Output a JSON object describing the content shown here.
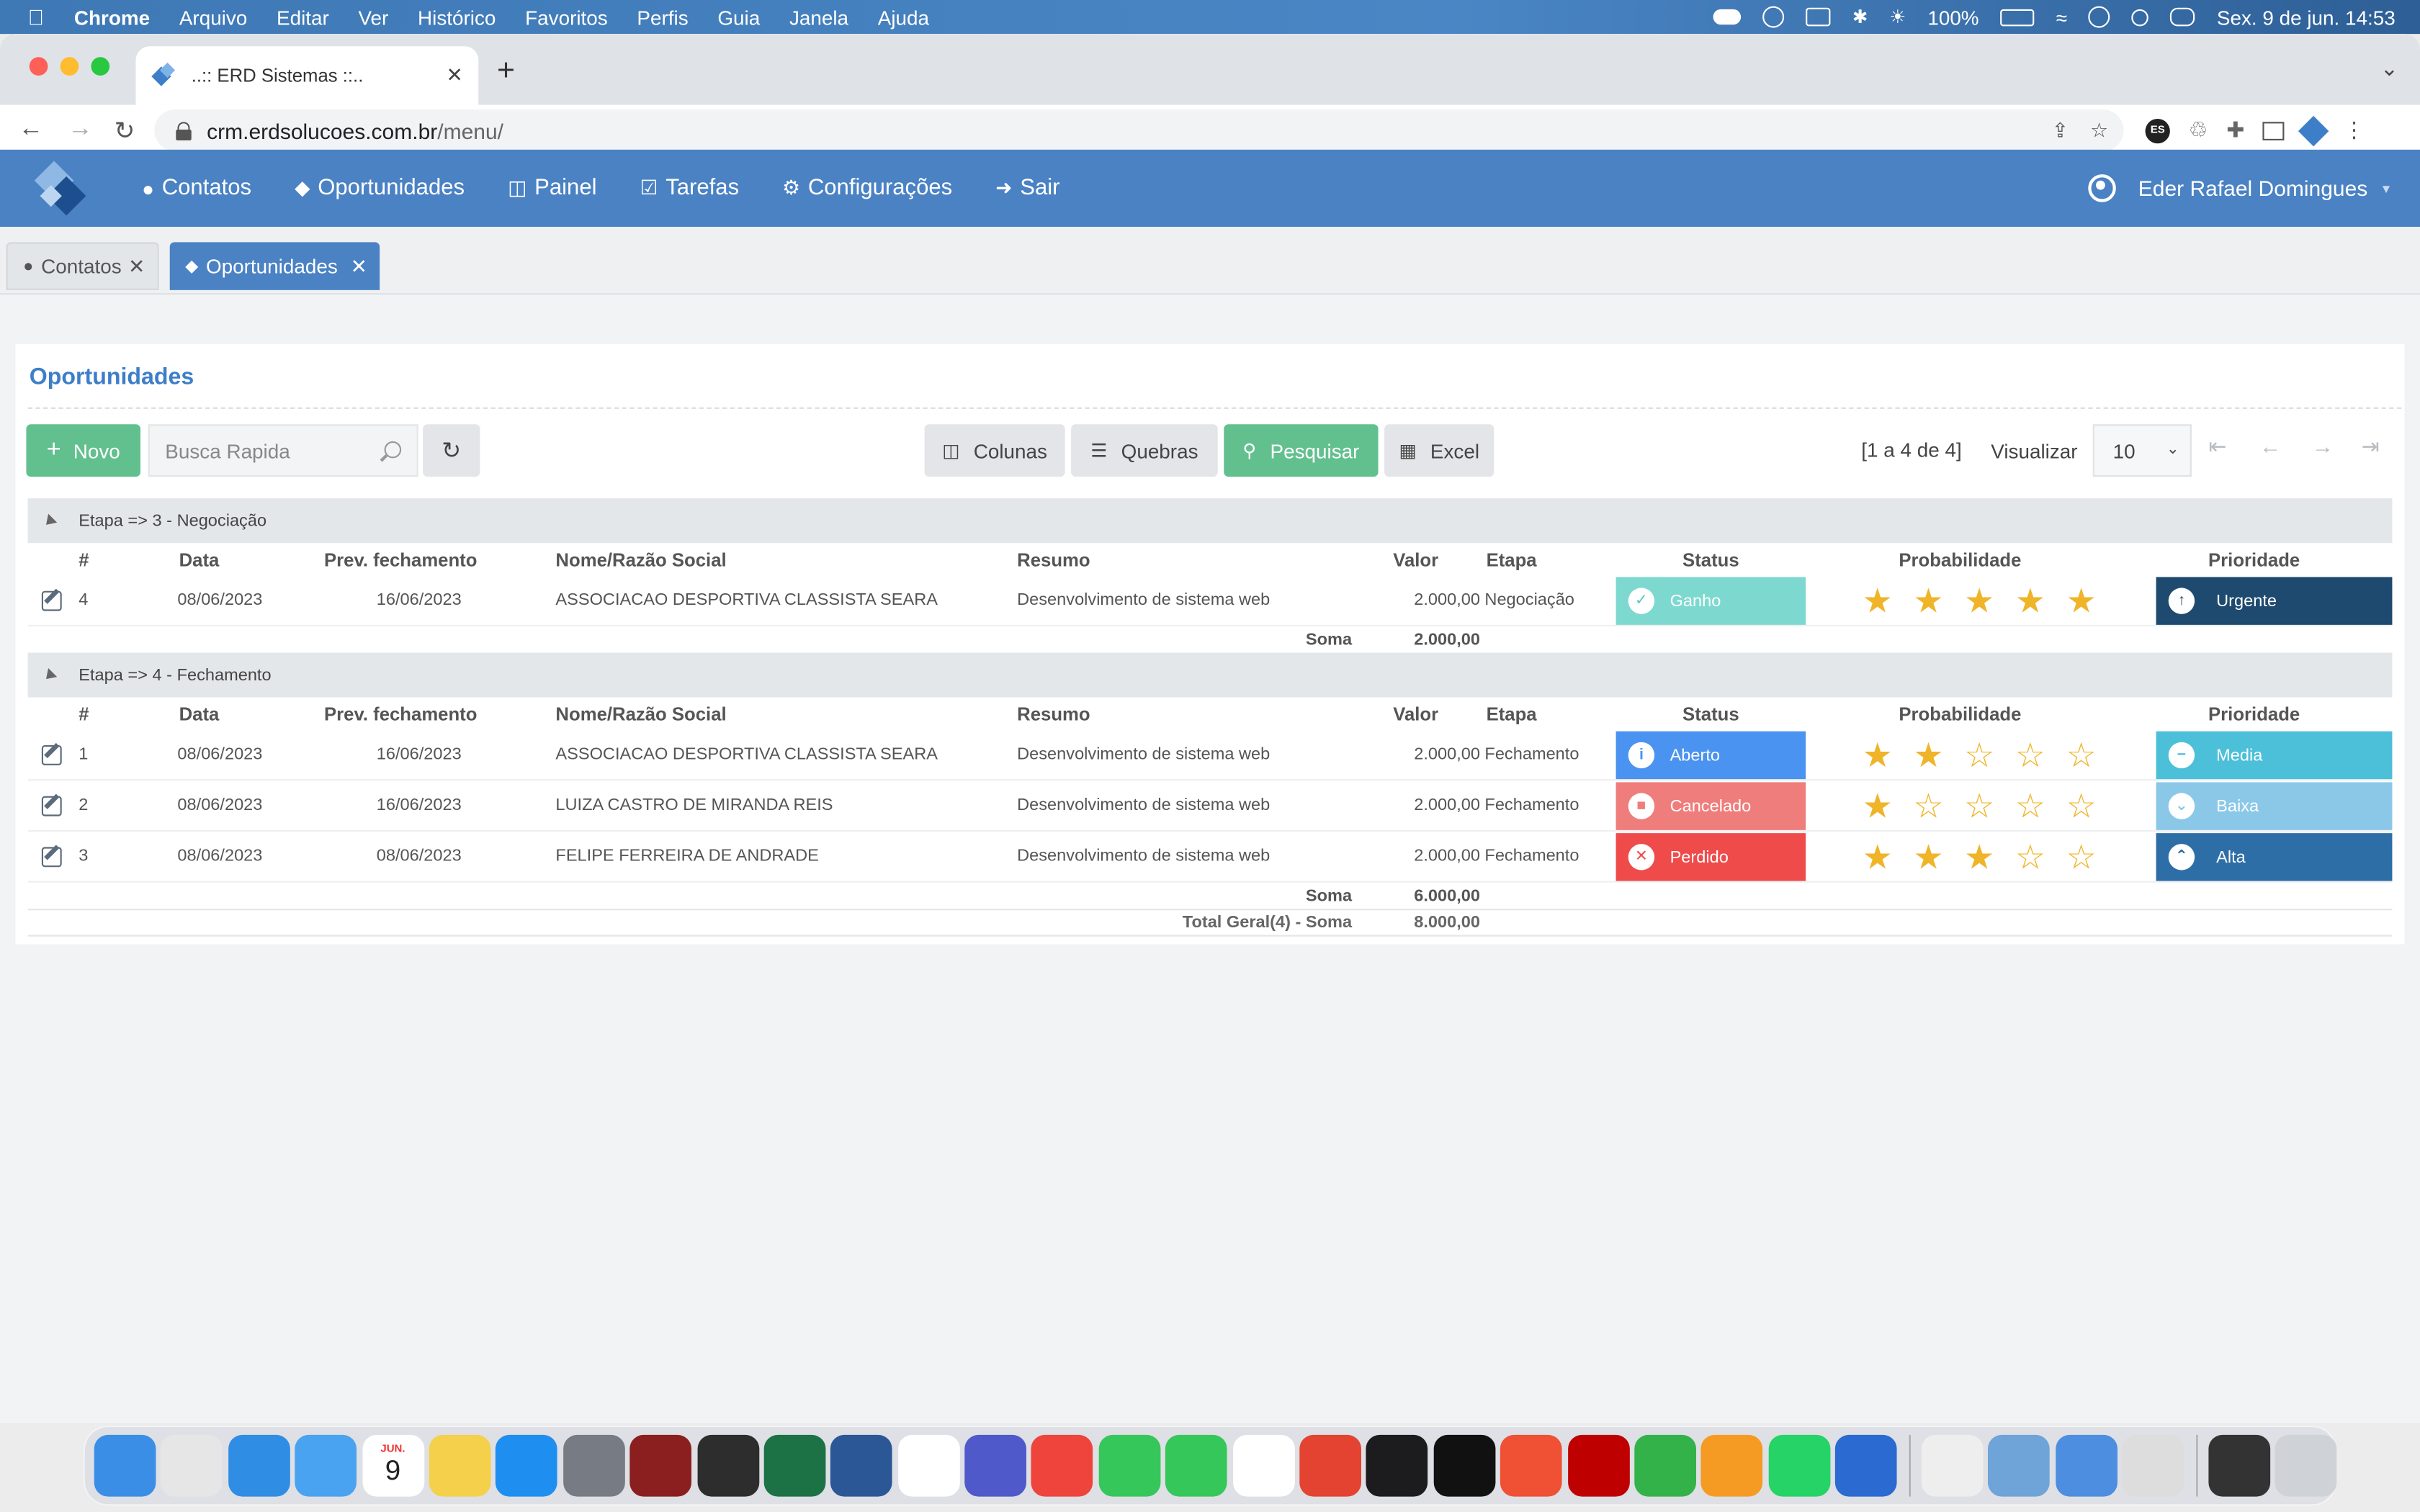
{
  "os_menubar": {
    "app": "Chrome",
    "items": [
      "Arquivo",
      "Editar",
      "Ver",
      "Histórico",
      "Favoritos",
      "Perfis",
      "Guia",
      "Janela",
      "Ajuda"
    ],
    "battery": "100%",
    "datetime": "Sex. 9 de jun.  14:53"
  },
  "browser": {
    "tab_title": "..:: ERD Sistemas ::..",
    "url_host": "crm.erdsolucoes.com.br",
    "url_path": "/menu/",
    "extension_badge": "ES"
  },
  "app_nav": {
    "items": [
      {
        "label": "Contatos",
        "icon": "user-icon"
      },
      {
        "label": "Oportunidades",
        "icon": "tags-icon"
      },
      {
        "label": "Painel",
        "icon": "columns-icon"
      },
      {
        "label": "Tarefas",
        "icon": "check-square-icon"
      },
      {
        "label": "Configurações",
        "icon": "cogs-icon"
      },
      {
        "label": "Sair",
        "icon": "sign-out-icon"
      }
    ],
    "user_name": "Eder Rafael Domingues"
  },
  "page_tabs": [
    {
      "label": "Contatos",
      "active": false
    },
    {
      "label": "Oportunidades",
      "active": true
    }
  ],
  "panel": {
    "title": "Oportunidades",
    "toolbar": {
      "novo": "Novo",
      "search_placeholder": "Busca Rapida",
      "colunas": "Colunas",
      "quebras": "Quebras",
      "pesquisar": "Pesquisar",
      "excel": "Excel",
      "record_count": "[1 a 4 de 4]",
      "visualizar_label": "Visualizar",
      "visualizar_value": "10"
    }
  },
  "columns": {
    "num": "#",
    "data": "Data",
    "prev": "Prev. fechamento",
    "nome": "Nome/Razão Social",
    "resumo": "Resumo",
    "valor": "Valor",
    "etapa": "Etapa",
    "status": "Status",
    "prob": "Probabilidade",
    "prio": "Prioridade"
  },
  "groups": [
    {
      "header": "Etapa  =>  3 - Negociação",
      "rows": [
        {
          "num": "4",
          "data": "08/06/2023",
          "prev": "16/06/2023",
          "nome": "ASSOCIACAO DESPORTIVA CLASSISTA SEARA",
          "resumo": "Desenvolvimento de sistema web",
          "valor": "2.000,00",
          "etapa": "Negociação",
          "status": "Ganho",
          "stars": 5,
          "prio": "Urgente"
        }
      ],
      "sum_label": "Soma",
      "sum_value": "2.000,00"
    },
    {
      "header": "Etapa  =>  4 - Fechamento",
      "rows": [
        {
          "num": "1",
          "data": "08/06/2023",
          "prev": "16/06/2023",
          "nome": "ASSOCIACAO DESPORTIVA CLASSISTA SEARA",
          "resumo": "Desenvolvimento de sistema web",
          "valor": "2.000,00",
          "etapa": "Fechamento",
          "status": "Aberto",
          "stars": 2,
          "prio": "Media"
        },
        {
          "num": "2",
          "data": "08/06/2023",
          "prev": "16/06/2023",
          "nome": "LUIZA CASTRO DE MIRANDA REIS",
          "resumo": "Desenvolvimento de sistema web",
          "valor": "2.000,00",
          "etapa": "Fechamento",
          "status": "Cancelado",
          "stars": 1,
          "prio": "Baixa"
        },
        {
          "num": "3",
          "data": "08/06/2023",
          "prev": "08/06/2023",
          "nome": "FELIPE FERREIRA DE ANDRADE",
          "resumo": "Desenvolvimento de sistema web",
          "valor": "2.000,00",
          "etapa": "Fechamento",
          "status": "Perdido",
          "stars": 3,
          "prio": "Alta"
        }
      ],
      "sum_label": "Soma",
      "sum_value": "6.000,00"
    }
  ],
  "total": {
    "label": "Total Geral(4) - Soma",
    "value": "8.000,00"
  },
  "dock_apps": [
    "Finder",
    "Launchpad",
    "Safari",
    "Mail",
    "Calendar",
    "Notes",
    "App Store",
    "System Preferences",
    "Photo Booth",
    "Sublime Text",
    "Excel",
    "Word",
    "Chrome",
    "Teams",
    "AnyDesk",
    "Messages",
    "FaceTime",
    "Photos",
    "Todoist",
    "QuickTime",
    "Apple TV",
    "Git",
    "FileZilla",
    "Numbers",
    "Pages",
    "WhatsApp",
    "SAP",
    "TextEdit",
    "Screenshot",
    "Preview",
    "Archive",
    "Terminal",
    "Trash"
  ],
  "dock_calendar": {
    "month": "JUN.",
    "day": "9"
  },
  "colors": {
    "brand_blue": "#4a82c4",
    "green": "#62c08f",
    "star": "#f0b429"
  }
}
